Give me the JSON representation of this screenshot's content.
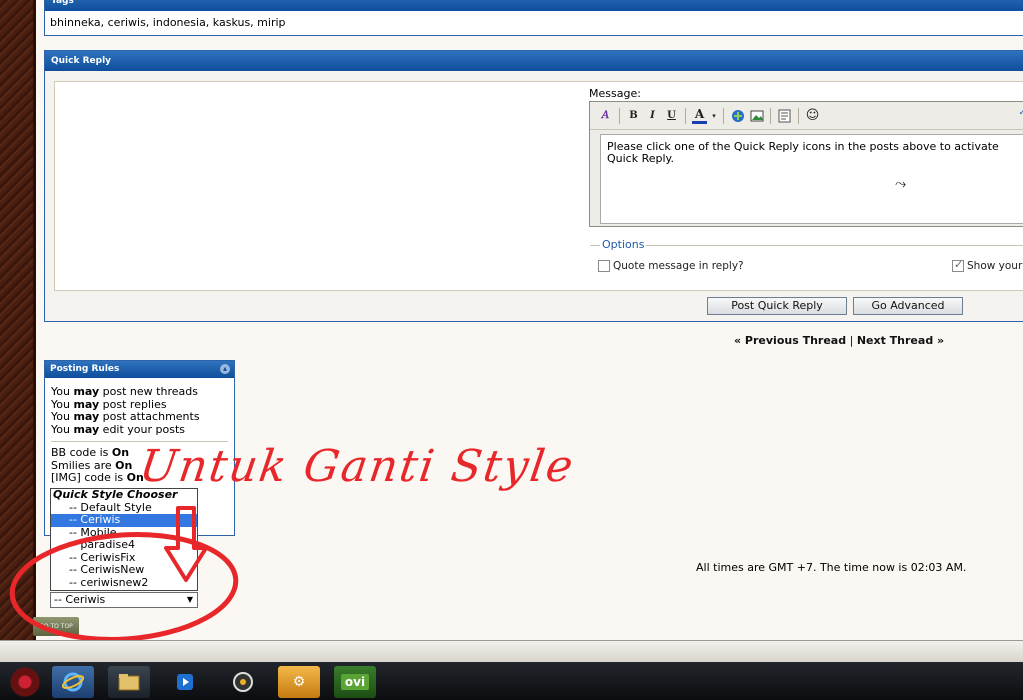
{
  "tags": {
    "header": "Tags",
    "value": "bhinneka, ceriwis, indonesia, kaskus, mirip"
  },
  "quick_reply": {
    "header": "Quick Reply",
    "message_label": "Message:",
    "toolbar": {
      "bold": "B",
      "italic": "I",
      "underline": "U",
      "font_color": "A"
    },
    "message_text": "Please click one of the Quick Reply icons in the posts above to activate Quick Reply.",
    "options_legend": "Options",
    "quote_label": "Quote message in reply?",
    "show_label": "Show your",
    "post_button": "Post Quick Reply",
    "advanced_button": "Go Advanced"
  },
  "thread_nav": {
    "prev": "« Previous Thread",
    "sep": "|",
    "next": "Next Thread »"
  },
  "posting_rules": {
    "header": "Posting Rules",
    "lines": [
      {
        "pre": "You ",
        "bold": "may",
        "post": " post new threads"
      },
      {
        "pre": "You ",
        "bold": "may",
        "post": " post replies"
      },
      {
        "pre": "You ",
        "bold": "may",
        "post": " post attachments"
      },
      {
        "pre": "You ",
        "bold": "may",
        "post": " edit your posts"
      }
    ],
    "codes": [
      {
        "pre": "BB code is ",
        "bold": "On"
      },
      {
        "pre": "Smilies are ",
        "bold": "On"
      },
      {
        "pre": "[IMG] code is ",
        "bold": "On"
      }
    ]
  },
  "style_chooser": {
    "group": "Quick Style Chooser",
    "options": [
      "-- Default Style",
      "-- Ceriwis",
      "-- Mobile",
      "-- paradise4",
      "-- CeriwisFix",
      "-- CeriwisNew",
      "-- ceriwisnew2"
    ],
    "selected_index": 1,
    "selected_value": "-- Ceriwis"
  },
  "go_to_top": "GO TO TOP",
  "time_info": "All times are GMT +7. The time now is 02:03 AM.",
  "annotation": {
    "text": "Untuk Ganti Style",
    "color": "#e8272a"
  },
  "taskbar": {
    "ovi_label": "ovi"
  }
}
